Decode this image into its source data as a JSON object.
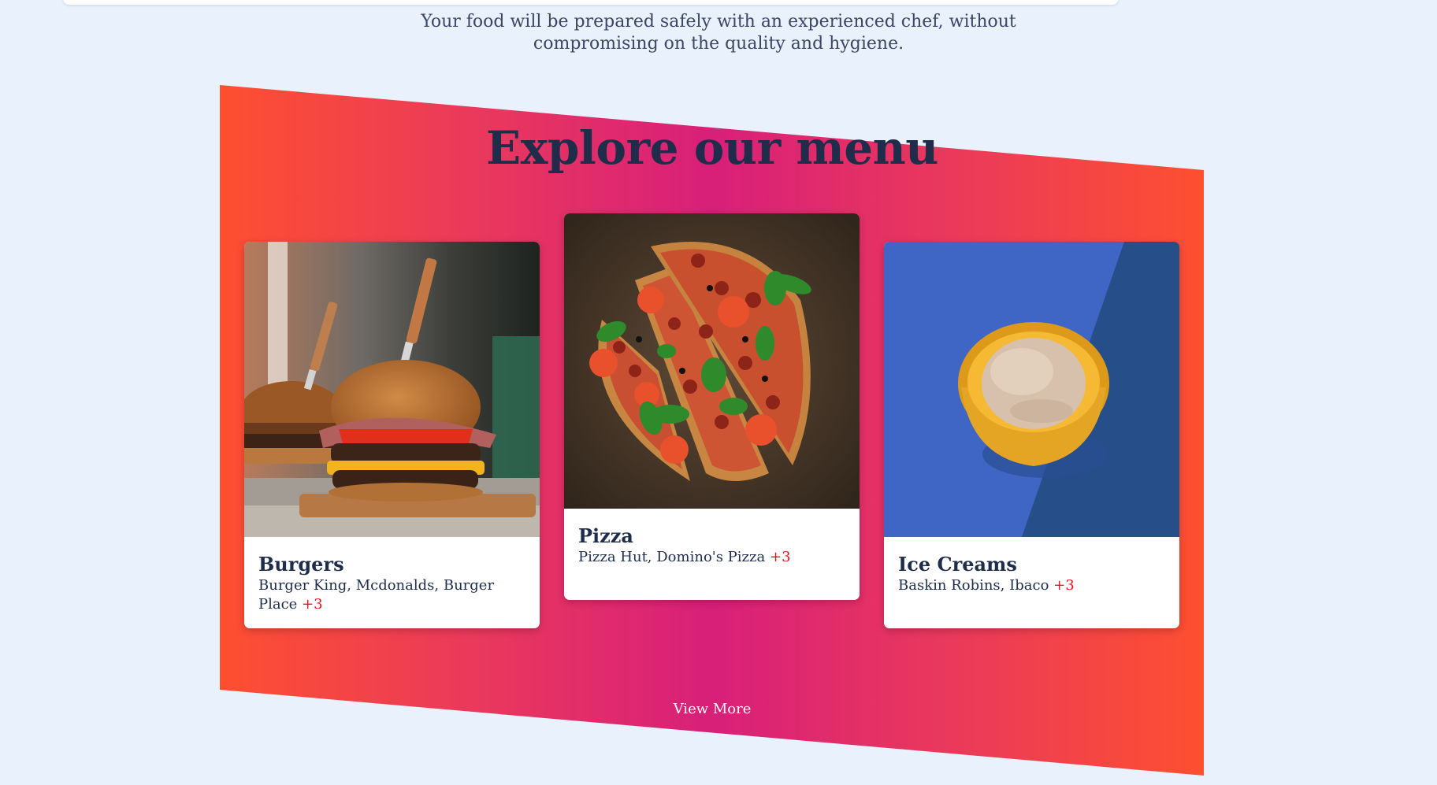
{
  "intro": {
    "line1": "Your food will be prepared safely with an experienced chef, without",
    "line2": "compromising on the quality and hygiene."
  },
  "menu": {
    "title": "Explore our menu",
    "view_more": "View More",
    "cards": [
      {
        "name": "Burgers",
        "restaurants": "Burger King, Mcdonalds, Burger Place",
        "more": "+3"
      },
      {
        "name": "Pizza",
        "restaurants": "Pizza Hut, Domino's Pizza",
        "more": "+3"
      },
      {
        "name": "Ice Creams",
        "restaurants": "Baskin Robins, Ibaco",
        "more": "+3"
      }
    ]
  },
  "colors": {
    "background": "#e9f1fd",
    "gradient_edge": "#fe4f31",
    "gradient_center": "#d81f79",
    "heading": "#1f2d4b",
    "accent_red": "#e8131f"
  },
  "icons": {
    "burger": "burger-photo",
    "pizza": "pizza-photo",
    "icecream": "ice-cream-photo"
  }
}
